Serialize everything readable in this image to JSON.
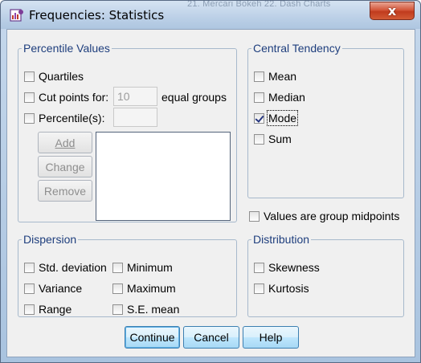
{
  "window": {
    "title": "Frequencies: Statistics",
    "close_label": "x",
    "background_text": "21. Mercari    Bokeh    22. Dash Charts"
  },
  "percentile_values": {
    "legend": "Percentile Values",
    "quartiles": {
      "label": "Quartiles",
      "checked": false
    },
    "cut_points": {
      "label": "Cut points for:",
      "value": "10",
      "suffix": "equal groups",
      "checked": false
    },
    "percentiles": {
      "label": "Percentile(s):",
      "value": "",
      "checked": false
    },
    "buttons": {
      "add": "Add",
      "change": "Change",
      "remove": "Remove"
    }
  },
  "central_tendency": {
    "legend": "Central Tendency",
    "mean": {
      "label": "Mean",
      "checked": false
    },
    "median": {
      "label": "Median",
      "checked": false
    },
    "mode": {
      "label": "Mode",
      "checked": true
    },
    "sum": {
      "label": "Sum",
      "checked": false
    }
  },
  "group_midpoints": {
    "label": "Values are group midpoints",
    "checked": false
  },
  "dispersion": {
    "legend": "Dispersion",
    "std_deviation": {
      "label": "Std. deviation",
      "checked": false
    },
    "variance": {
      "label": "Variance",
      "checked": false
    },
    "range": {
      "label": "Range",
      "checked": false
    },
    "minimum": {
      "label": "Minimum",
      "checked": false
    },
    "maximum": {
      "label": "Maximum",
      "checked": false
    },
    "se_mean": {
      "label": "S.E. mean",
      "checked": false
    }
  },
  "distribution": {
    "legend": "Distribution",
    "skewness": {
      "label": "Skewness",
      "checked": false
    },
    "kurtosis": {
      "label": "Kurtosis",
      "checked": false
    }
  },
  "footer": {
    "continue": "Continue",
    "cancel": "Cancel",
    "help": "Help"
  }
}
